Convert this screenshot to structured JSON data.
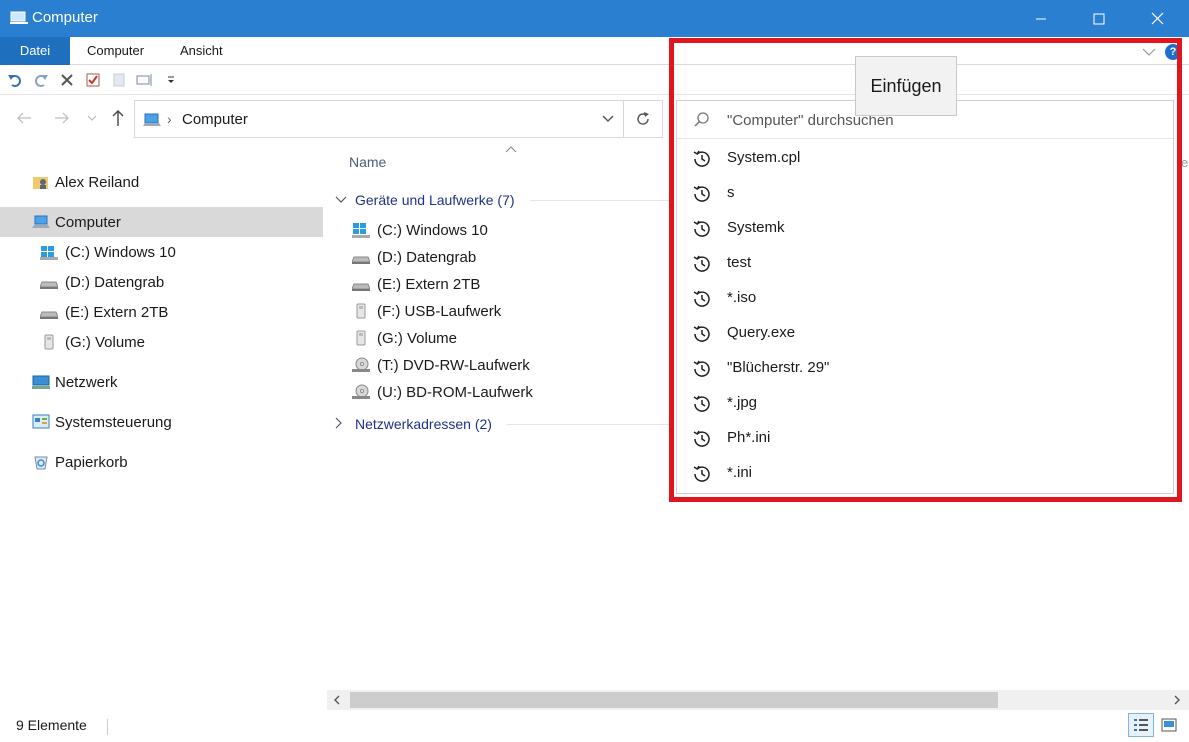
{
  "window": {
    "title": "Computer"
  },
  "ribbon": {
    "tabs": [
      "Datei",
      "Computer",
      "Ansicht"
    ]
  },
  "address": {
    "path": "Computer"
  },
  "sidebar": {
    "items": [
      {
        "label": "Alex Reiland",
        "icon": "user-folder-icon"
      },
      {
        "label": "Computer",
        "icon": "computer-icon",
        "selected": true
      },
      {
        "label": "(C:) Windows 10",
        "icon": "windows-drive-icon"
      },
      {
        "label": "(D:) Datengrab",
        "icon": "hard-drive-icon"
      },
      {
        "label": "(E:) Extern 2TB",
        "icon": "hard-drive-icon"
      },
      {
        "label": "(G:) Volume",
        "icon": "usb-drive-icon"
      },
      {
        "label": "Netzwerk",
        "icon": "network-icon"
      },
      {
        "label": "Systemsteuerung",
        "icon": "control-panel-icon"
      },
      {
        "label": "Papierkorb",
        "icon": "recycle-bin-icon"
      }
    ]
  },
  "content": {
    "column_header": "Name",
    "groups": [
      {
        "title": "Geräte und Laufwerke (7)",
        "items": [
          {
            "label": "(C:) Windows 10",
            "icon": "windows-drive-icon"
          },
          {
            "label": "(D:) Datengrab",
            "icon": "hard-drive-icon"
          },
          {
            "label": "(E:) Extern 2TB",
            "icon": "hard-drive-icon"
          },
          {
            "label": "(F:) USB-Laufwerk",
            "icon": "usb-drive-icon"
          },
          {
            "label": "(G:) Volume",
            "icon": "usb-drive-icon"
          },
          {
            "label": "(T:) DVD-RW-Laufwerk",
            "icon": "optical-drive-icon"
          },
          {
            "label": "(U:) BD-ROM-Laufwerk",
            "icon": "optical-drive-icon"
          }
        ]
      },
      {
        "title": "Netzwerkadressen (2)"
      }
    ]
  },
  "search": {
    "placeholder": "\"Computer\" durchsuchen",
    "history": [
      "System.cpl",
      "s",
      "Systemk",
      "test",
      "*.iso",
      "Query.exe",
      "\"Blücherstr. 29\"",
      "*.jpg",
      "Ph*.ini",
      "*.ini"
    ]
  },
  "tooltip": {
    "text": "Einfügen"
  },
  "status": {
    "count": "9 Elemente"
  },
  "colors": {
    "titlebar": "#2b7fd0",
    "file_tab": "#1f6fbf",
    "highlight": "#e0161e",
    "group_header": "#1e3287"
  }
}
